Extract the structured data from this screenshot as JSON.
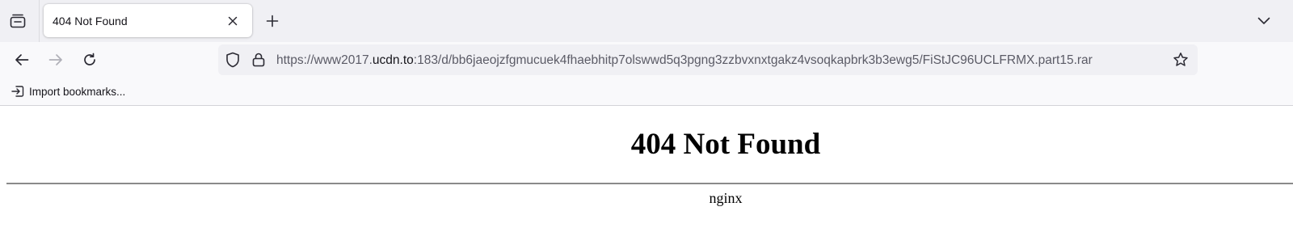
{
  "tabs": [
    {
      "title": "404 Not Found",
      "active": true
    }
  ],
  "icons": {
    "tab_overview": "tab-overview-icon",
    "tab_close": "close-icon",
    "new_tab": "plus-icon",
    "tab_list": "chevron-down-icon",
    "back": "arrow-left-icon",
    "forward": "arrow-right-icon",
    "reload": "reload-icon",
    "tracking_protection": "shield-icon",
    "site_security": "lock-icon",
    "bookmark": "star-icon",
    "import": "import-icon"
  },
  "urlbar": {
    "prefix": "https://www2017.",
    "domain": "ucdn.to",
    "suffix": ":183/d/bb6jaeojzfgmucuek4fhaebhitp7olswwd5q3pgng3zzbvxnxtgakz4vsoqkapbrk3b3ewg5/FiStJC96UCLFRMX.part15.rar"
  },
  "bookmarks_bar": {
    "import_label": "Import bookmarks..."
  },
  "page": {
    "heading": "404 Not Found",
    "footer": "nginx"
  },
  "colors": {
    "tabstrip_bg": "#f0f0f4",
    "toolbar_bg": "#f9f9fb",
    "urlbar_bg": "#f0f0f4",
    "text_primary": "#15141a",
    "text_secondary": "#5b5b66",
    "forward_disabled": "#b0b0b8"
  }
}
